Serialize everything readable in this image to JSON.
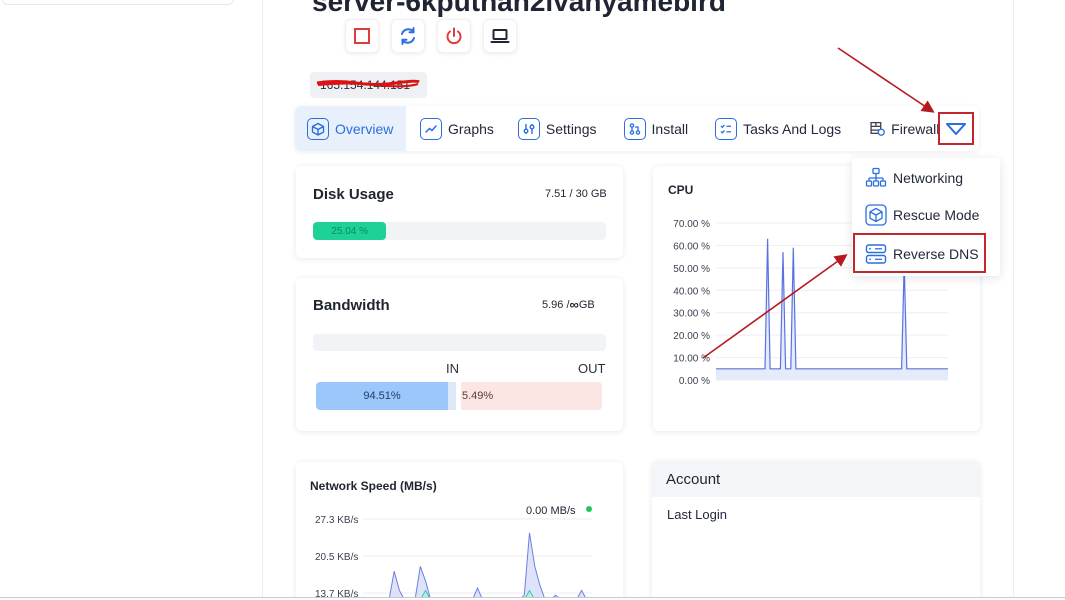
{
  "server": {
    "title": "server-6kputhan2ivanyamebird",
    "ip": "165.154.144.151"
  },
  "power_buttons": [
    {
      "name": "stop-icon",
      "color": "#e23b3b"
    },
    {
      "name": "restart-icon",
      "color": "#2a6ee0"
    },
    {
      "name": "power-icon",
      "color": "#e23b3b"
    },
    {
      "name": "console-icon",
      "color": "#1f2430"
    }
  ],
  "tabs": [
    {
      "label": "Overview",
      "icon": "cube-icon",
      "active": true
    },
    {
      "label": "Graphs",
      "icon": "chart-line-icon"
    },
    {
      "label": "Settings",
      "icon": "sliders-icon"
    },
    {
      "label": "Install",
      "icon": "git-icon"
    },
    {
      "label": "Tasks And Logs",
      "icon": "checklist-icon"
    },
    {
      "label": "Firewall",
      "icon": "firewall-icon"
    }
  ],
  "more_tab": {
    "icon": "chevron-down-icon"
  },
  "dropdown": {
    "items": [
      {
        "label": "Networking",
        "icon": "network-icon"
      },
      {
        "label": "Rescue Mode",
        "icon": "cube-icon"
      },
      {
        "label": "Reverse DNS",
        "icon": "server-icon"
      }
    ]
  },
  "disk": {
    "title": "Disk Usage",
    "value": "7.51 / 30 GB",
    "percent_label": "25.04 %",
    "percent": 25.04
  },
  "bandwidth": {
    "title": "Bandwidth",
    "value_prefix": "5.96 / ",
    "value_suffix": " GB",
    "infinity": "∞",
    "in_label": "IN",
    "out_label": "OUT",
    "in_percent_label": "94.51%",
    "out_percent_label": "5.49%",
    "in_percent": 94.51,
    "out_percent": 5.49
  },
  "cpu": {
    "title": "CPU",
    "ticks": [
      "70.00 %",
      "60.00 %",
      "50.00 %",
      "40.00 %",
      "30.00 %",
      "20.00 %",
      "10.00 %",
      "0.00 %"
    ]
  },
  "network": {
    "title": "Network Speed (MB/s)",
    "current": "0.00 MB/s",
    "ticks": [
      "27.3 KB/s",
      "20.5 KB/s",
      "13.7 KB/s"
    ]
  },
  "account": {
    "title": "Account",
    "last_login_label": "Last Login"
  },
  "chart_data": [
    {
      "type": "line",
      "title": "CPU",
      "ylim": [
        0,
        70
      ],
      "y_ticks": [
        70,
        60,
        50,
        40,
        30,
        20,
        10,
        0
      ],
      "series": [
        {
          "values": [
            5,
            5,
            5,
            5,
            5,
            5,
            5,
            5,
            5,
            5,
            5,
            5,
            5,
            5,
            5,
            5,
            5,
            5,
            5,
            5,
            63,
            5,
            5,
            5,
            5,
            5,
            57,
            5,
            5,
            5,
            59,
            5,
            5,
            5,
            5,
            5,
            5,
            5,
            5,
            5,
            5,
            5,
            5,
            5,
            5,
            5,
            5,
            5,
            5,
            5,
            5,
            5,
            5,
            5,
            5,
            5,
            5,
            5,
            5,
            5,
            5,
            5,
            5,
            5,
            5,
            5,
            5,
            5,
            5,
            5,
            5,
            5,
            5,
            52,
            5,
            5,
            5,
            5,
            5,
            5,
            5,
            5,
            5,
            5,
            5,
            5,
            5,
            5,
            5,
            5,
            5
          ]
        }
      ]
    },
    {
      "type": "area",
      "title": "Network Speed (MB/s)",
      "y_ticks_label": [
        "27.3 KB/s",
        "20.5 KB/s",
        "13.7 KB/s"
      ],
      "ylim": [
        13.7,
        27.3
      ],
      "series": [
        {
          "color": "#6c7fe0",
          "values": [
            0,
            0,
            0,
            0,
            0,
            0,
            12,
            4,
            0,
            0,
            0,
            14,
            8,
            0,
            0,
            0,
            0,
            0,
            0,
            0,
            0,
            0,
            5,
            0,
            0,
            0,
            0,
            0,
            0,
            0,
            0,
            2,
            28,
            14,
            6,
            0,
            0,
            2,
            0,
            0,
            0,
            0,
            4,
            0,
            0
          ]
        },
        {
          "color": "#38c8a8",
          "values": [
            0,
            0,
            0,
            0,
            0,
            0,
            0,
            0,
            0,
            0,
            0,
            0,
            4,
            0,
            0,
            0,
            0,
            0,
            0,
            0,
            0,
            0,
            0,
            0,
            0,
            0,
            0,
            0,
            0,
            0,
            0,
            0,
            4,
            0,
            0,
            0,
            0,
            0,
            0,
            0,
            0,
            0,
            0,
            0,
            0
          ]
        }
      ]
    }
  ]
}
